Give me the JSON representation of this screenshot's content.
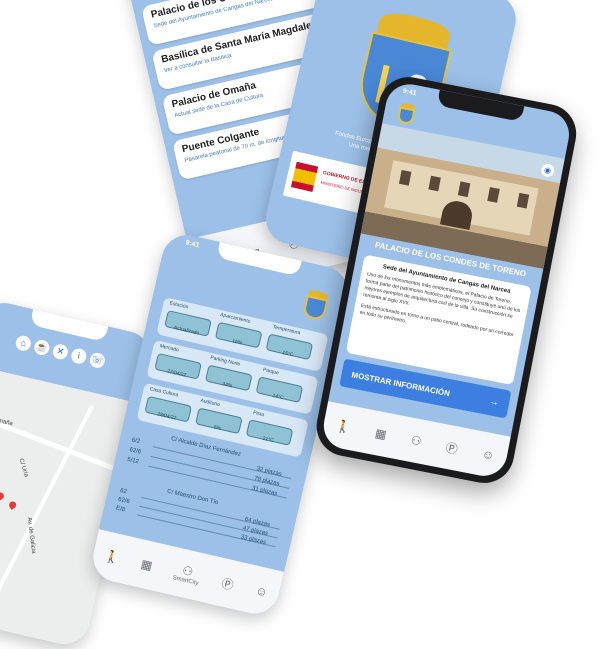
{
  "phone_list": {
    "places": [
      {
        "title": "Palacio de los Condes de Toreno",
        "subtitle": "Sede del Ayuntamiento de Cangas del Narcea"
      },
      {
        "title": "Basílica de Santa María Magdalena",
        "subtitle": "Ver a consultar la Basílica"
      },
      {
        "title": "Palacio de Omaña",
        "subtitle": "Actual sede de la Casa de Cultura"
      },
      {
        "title": "Puente Colgante",
        "subtitle": "Pasarela peatonal de 70 m. de longitud y 20 m."
      }
    ],
    "top_icons": [
      "home-icon",
      "restaurant-icon",
      "tools-icon",
      "info-icon",
      "phone-icon"
    ]
  },
  "phone_sponsor": {
    "caption_line1": "Fondos Europeos de Desarrollo Regional",
    "caption_line2": "Una manera de hacer Europa",
    "ministry_text": "GOBIERNO DE ESPAÑA",
    "ministry_sub": "MINISTERIO DE INDUSTRIA, COMERCIO Y TURISMO"
  },
  "phone_detail": {
    "status_time": "9:41",
    "place_title": "PALACIO DE LOS CONDES DE TORENO",
    "subtitle": "Sede del Ayuntamiento de Cangas del Narcea",
    "paragraph1": "Uno de los monumentos más emblemáticos, el Palacio de Toreno, forma parte del patrimonio histórico del concejo y constituye uno de los mejores ejemplos de arquitectura civil de la villa. Su construcción se remonta al siglo XVII.",
    "paragraph2": "Está estructurado en torno a un patio central, rodeado por un corredor en todo su perímetro.",
    "button_label": "MOSTRAR INFORMACIÓN",
    "button_arrow": "→"
  },
  "phone_traffic": {
    "status_time": "9:41",
    "panels": [
      {
        "labels": [
          "Estación",
          "Aparcamiento",
          "Temperatura"
        ],
        "values": [
          "Actualizado",
          "16%",
          "15°C"
        ]
      },
      {
        "labels": [
          "Mercado",
          "Parking Norte",
          "Parque"
        ],
        "values": [
          "27/04/22",
          "34%",
          "14°C"
        ]
      },
      {
        "labels": [
          "Casa Cultura",
          "Auditorio",
          "Pista"
        ],
        "values": [
          "28/04/22",
          "6%",
          "21°C"
        ]
      }
    ],
    "streets": [
      {
        "name": "C/ Alcalde Díaz Fernández",
        "rows": [
          "6/2",
          "62/6",
          "5/12"
        ],
        "totals": [
          "32 plazas",
          "78 plazas",
          "31 plazas"
        ]
      },
      {
        "name": "C/ Maestro Don Tío",
        "rows": [
          "62",
          "62/6",
          "E/8"
        ],
        "totals": [
          "64 plazas",
          "47 plazas",
          "33 plazas"
        ]
      }
    ],
    "nav_label": "SmartCity"
  },
  "phone_map": {
    "street_label": "Palacio de Omaña",
    "road_labels": [
      "C/ Uría",
      "Av. de Galicia"
    ]
  },
  "nav_icons": [
    "walk-icon",
    "map-icon",
    "bike-icon",
    "parking-icon",
    "user-icon"
  ],
  "colors": {
    "screen_blue": "#9cc0e8",
    "accent_blue": "#2f6fbf",
    "button_blue": "#3c7fe0",
    "gold": "#e5b62c"
  }
}
